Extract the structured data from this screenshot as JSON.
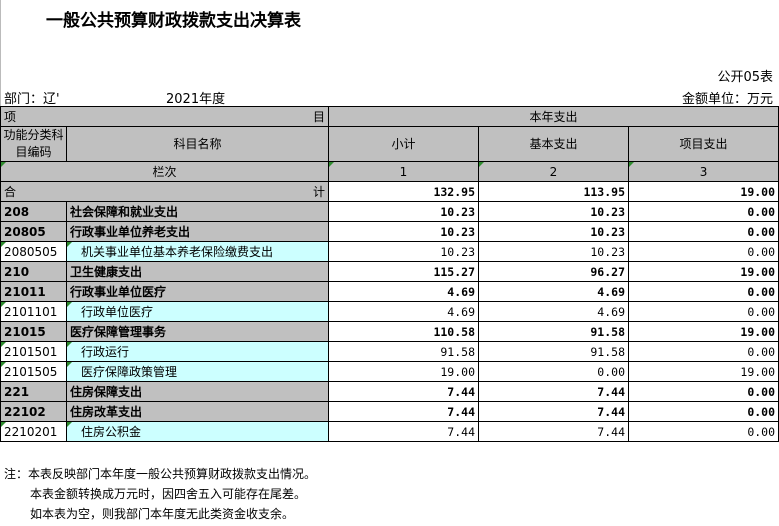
{
  "title": "一般公共预算财政拨款支出决算表",
  "form_no": "公开05表",
  "dept": "部门：辽'",
  "year": "2021年度",
  "unit": "金额单位：万元",
  "header": {
    "item_left": "项",
    "item_right": "目",
    "this_year": "本年支出",
    "func_code": "功能分类科目编码",
    "subject_name": "科目名称",
    "subtotal": "小计",
    "basic": "基本支出",
    "project": "项目支出",
    "col_label": "栏次",
    "col1": "1",
    "col2": "2",
    "col3": "3"
  },
  "total": {
    "left": "合",
    "right": "计",
    "subtotal": "132.95",
    "basic": "113.95",
    "project": "19.00"
  },
  "rows": [
    {
      "code": "208",
      "name": "社会保障和就业支出",
      "subtotal": "10.23",
      "basic": "10.23",
      "project": "0.00",
      "level": "top"
    },
    {
      "code": "20805",
      "name": "行政事业单位养老支出",
      "subtotal": "10.23",
      "basic": "10.23",
      "project": "0.00",
      "level": "mid"
    },
    {
      "code": "2080505",
      "name": "机关事业单位基本养老保险缴费支出",
      "subtotal": "10.23",
      "basic": "10.23",
      "project": "0.00",
      "level": "leaf"
    },
    {
      "code": "210",
      "name": "卫生健康支出",
      "subtotal": "115.27",
      "basic": "96.27",
      "project": "19.00",
      "level": "top"
    },
    {
      "code": "21011",
      "name": "行政事业单位医疗",
      "subtotal": "4.69",
      "basic": "4.69",
      "project": "0.00",
      "level": "mid"
    },
    {
      "code": "2101101",
      "name": "行政单位医疗",
      "subtotal": "4.69",
      "basic": "4.69",
      "project": "0.00",
      "level": "leaf"
    },
    {
      "code": "21015",
      "name": "医疗保障管理事务",
      "subtotal": "110.58",
      "basic": "91.58",
      "project": "19.00",
      "level": "mid"
    },
    {
      "code": "2101501",
      "name": "行政运行",
      "subtotal": "91.58",
      "basic": "91.58",
      "project": "0.00",
      "level": "leaf"
    },
    {
      "code": "2101505",
      "name": "医疗保障政策管理",
      "subtotal": "19.00",
      "basic": "0.00",
      "project": "19.00",
      "level": "leaf"
    },
    {
      "code": "221",
      "name": "住房保障支出",
      "subtotal": "7.44",
      "basic": "7.44",
      "project": "0.00",
      "level": "top"
    },
    {
      "code": "22102",
      "name": "住房改革支出",
      "subtotal": "7.44",
      "basic": "7.44",
      "project": "0.00",
      "level": "mid"
    },
    {
      "code": "2210201",
      "name": "住房公积金",
      "subtotal": "7.44",
      "basic": "7.44",
      "project": "0.00",
      "level": "leaf"
    }
  ],
  "notes": [
    "注：本表反映部门本年度一般公共预算财政拨款支出情况。",
    "本表金额转换成万元时，因四舍五入可能存在尾差。",
    "如本表为空，则我部门本年度无此类资金收支余。"
  ]
}
